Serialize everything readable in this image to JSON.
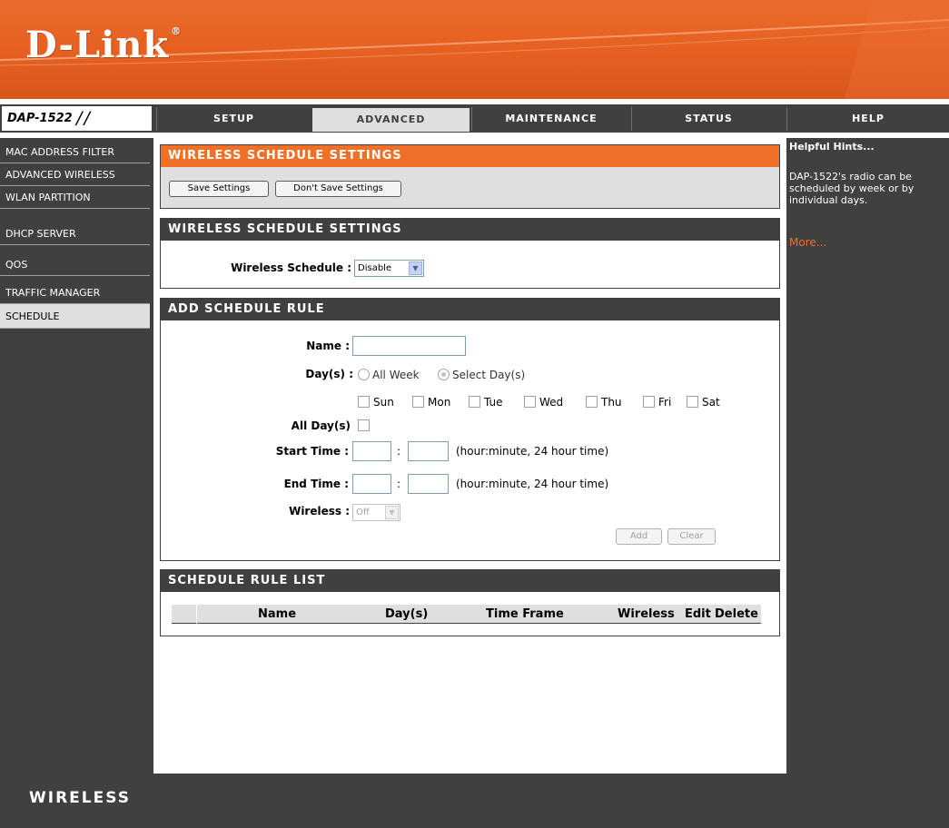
{
  "brand": {
    "logo": "D-Link",
    "reg_mark": "®",
    "model": "DAP-1522",
    "model_slashes": "/ /"
  },
  "tabs": [
    {
      "label": "SETUP"
    },
    {
      "label": "ADVANCED"
    },
    {
      "label": "MAINTENANCE"
    },
    {
      "label": "STATUS"
    },
    {
      "label": "HELP"
    }
  ],
  "sidebar": {
    "items": [
      {
        "label": "MAC ADDRESS FILTER"
      },
      {
        "label": "ADVANCED WIRELESS"
      },
      {
        "label": "WLAN PARTITION"
      },
      {
        "label": "DHCP SERVER"
      },
      {
        "label": "QOS"
      },
      {
        "label": "TRAFFIC MANAGER"
      },
      {
        "label": "SCHEDULE"
      }
    ]
  },
  "section1": {
    "title": "WIRELESS SCHEDULE SETTINGS",
    "save_label": "Save Settings",
    "dontsave_label": "Don't Save Settings"
  },
  "section2": {
    "title": "WIRELESS SCHEDULE SETTINGS",
    "schedule_label": "Wireless Schedule :",
    "schedule_value": "Disable"
  },
  "section3": {
    "title": "ADD SCHEDULE RULE",
    "name_label": "Name :",
    "days_label": "Day(s) :",
    "all_week": "All Week",
    "select_days": "Select Day(s)",
    "weekdays": [
      "Sun",
      "Mon",
      "Tue",
      "Wed",
      "Thu",
      "Fri",
      "Sat"
    ],
    "all_days_label": "All Day(s)",
    "start_label": "Start Time :",
    "end_label": "End Time :",
    "time_sep": ":",
    "time_hint": "(hour:minute, 24 hour time)",
    "wireless_label": "Wireless :",
    "wireless_value": "Off",
    "add_label": "Add",
    "clear_label": "Clear"
  },
  "section4": {
    "title": "SCHEDULE RULE LIST",
    "columns": [
      "Name",
      "Day(s)",
      "Time Frame",
      "Wireless",
      "Edit",
      "Delete"
    ]
  },
  "help": {
    "title": "Helpful Hints...",
    "body": "DAP-1522's radio can be scheduled by week or by individual days.",
    "more": "More..."
  },
  "footer": {
    "label": "WIRELESS"
  }
}
